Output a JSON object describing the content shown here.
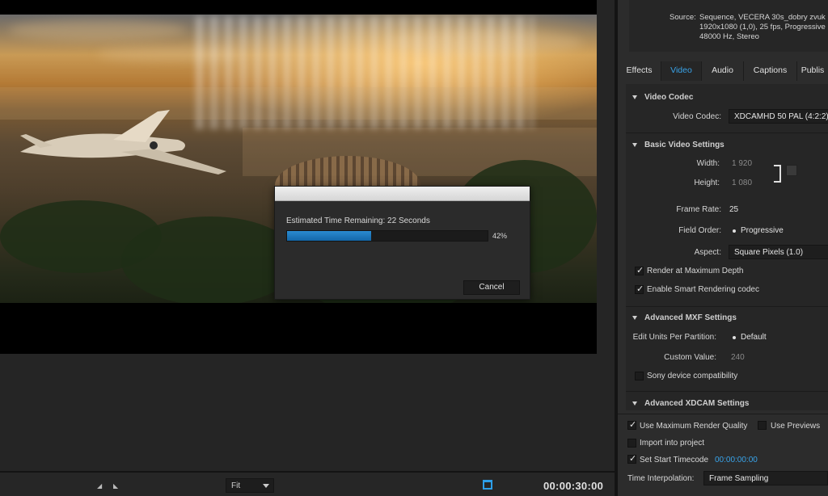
{
  "dialog": {
    "message": "Estimated Time Remaining: 22 Seconds",
    "progress_label": "42%",
    "progress": 0.42,
    "cancel_label": "Cancel"
  },
  "transport": {
    "zoom_value": "Fit",
    "duration": "00:00:30:00"
  },
  "source": {
    "label": "Source:",
    "lines": [
      "Sequence, VECERA 30s_dobry zvuk",
      "1920x1080 (1,0), 25 fps, Progressive",
      "48000 Hz, Stereo"
    ]
  },
  "tabs": [
    "Effects",
    "Video",
    "Audio",
    "Captions",
    "Publis"
  ],
  "video_codec": {
    "section": "Video Codec",
    "label": "Video Codec:",
    "value": "XDCAMHD 50 PAL (4:2:2)"
  },
  "basic": {
    "section": "Basic Video Settings",
    "width_label": "Width:",
    "width": "1 920",
    "height_label": "Height:",
    "height": "1 080",
    "frame_rate_label": "Frame Rate:",
    "frame_rate": "25",
    "field_order_label": "Field Order:",
    "field_order": "Progressive",
    "aspect_label": "Aspect:",
    "aspect": "Square Pixels (1.0)",
    "render_max_depth": "Render at Maximum Depth",
    "smart_rendering": "Enable Smart Rendering codec"
  },
  "mxf": {
    "section": "Advanced MXF Settings",
    "edit_units_label": "Edit Units Per Partition:",
    "edit_units": "Default",
    "custom_label": "Custom Value:",
    "custom_value": "240",
    "sony_compat": "Sony device compatibility"
  },
  "xdcam": {
    "section": "Advanced XDCAM Settings"
  },
  "bottom": {
    "max_render_quality": "Use Maximum Render Quality",
    "use_previews": "Use Previews",
    "import_into_project": "Import into project",
    "set_start_timecode": "Set Start Timecode",
    "start_timecode": "00:00:00:00",
    "interpolation_label": "Time Interpolation:",
    "interpolation_value": "Frame Sampling"
  },
  "colors": {
    "accent": "#39a4ea",
    "progress": "#1a78c0"
  }
}
